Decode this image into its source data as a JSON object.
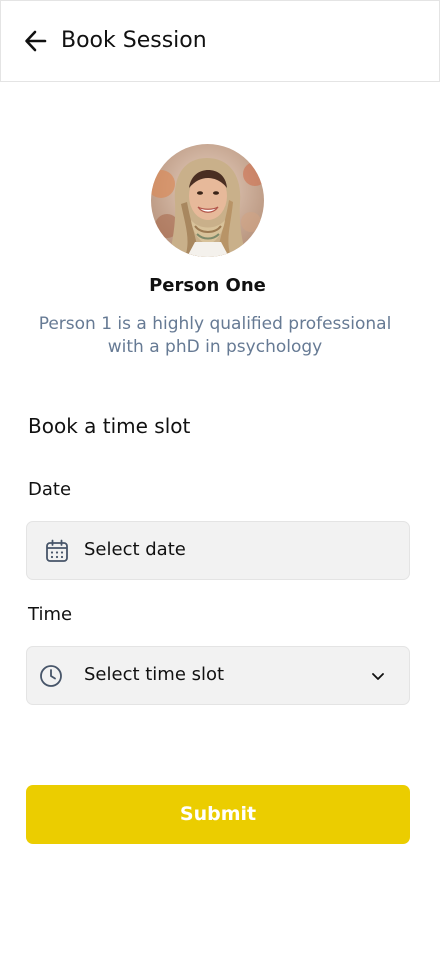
{
  "header": {
    "title": "Book Session",
    "back_icon": "arrow-left-icon"
  },
  "profile": {
    "name": "Person One",
    "description": "Person 1 is a highly qualified professional with a phD in psychology"
  },
  "booking": {
    "heading": "Book a time slot",
    "date": {
      "label": "Date",
      "placeholder": "Select date",
      "icon": "calendar-icon"
    },
    "time": {
      "label": "Time",
      "placeholder": "Select time slot",
      "icon": "clock-icon",
      "dropdown_icon": "chevron-down-icon"
    }
  },
  "submit": {
    "label": "Submit",
    "color": "#ebcd00"
  },
  "colors": {
    "accent": "#ebcd00",
    "description_text": "#667a94",
    "field_bg": "#f2f2f2"
  }
}
